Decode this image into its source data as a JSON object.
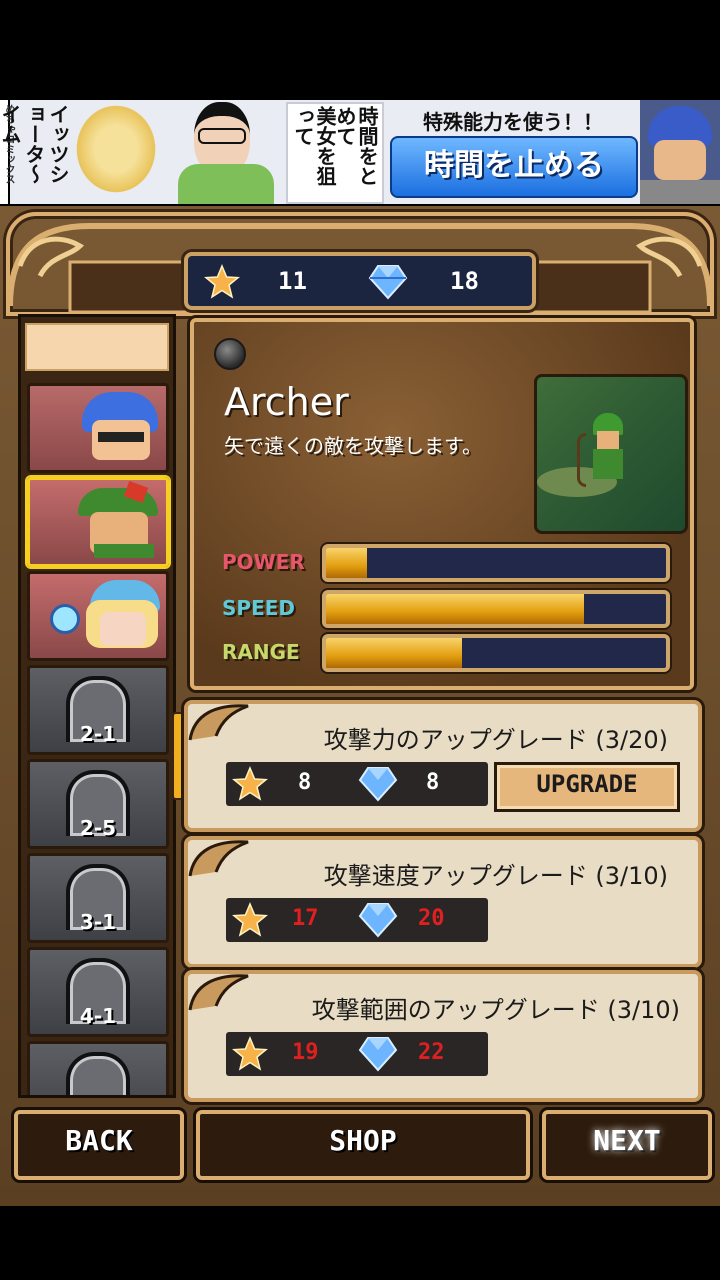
{
  "ad": {
    "col1": "イッツショータ～イム",
    "col2": "美女を狙って",
    "col3": "時間をとめて",
    "tagline": "特殊能力を使う！！",
    "button": "時間を止める",
    "side_text": "めちゃコミックス"
  },
  "currency": {
    "stars": "11",
    "gems": "18"
  },
  "character": {
    "name": "Archer",
    "description": "矢で遠くの敵を攻撃します。",
    "stats": [
      {
        "label": "POWER",
        "value": 0.12,
        "color": "#e8566a"
      },
      {
        "label": "SPEED",
        "value": 0.76,
        "color": "#5fc9d8"
      },
      {
        "label": "RANGE",
        "value": 0.4,
        "color": "#c7d86a"
      }
    ]
  },
  "sidebar": {
    "locked_stages": [
      "2-1",
      "2-5",
      "3-1",
      "4-1"
    ]
  },
  "upgrades": [
    {
      "title": "攻撃力のアップグレード (3/20)",
      "star_cost": "8",
      "gem_cost": "8",
      "button": "UPGRADE",
      "affordable": true
    },
    {
      "title": "攻撃速度アップグレード (3/10)",
      "star_cost": "17",
      "gem_cost": "20",
      "affordable": false
    },
    {
      "title": "攻撃範囲のアップグレード (3/10)",
      "star_cost": "19",
      "gem_cost": "22",
      "affordable": false
    }
  ],
  "nav": {
    "back": "BACK",
    "shop": "SHOP",
    "next": "NEXT"
  },
  "colors": {
    "affordable_cost": "#ffffff",
    "unaffordable_cost": "#e02020"
  }
}
